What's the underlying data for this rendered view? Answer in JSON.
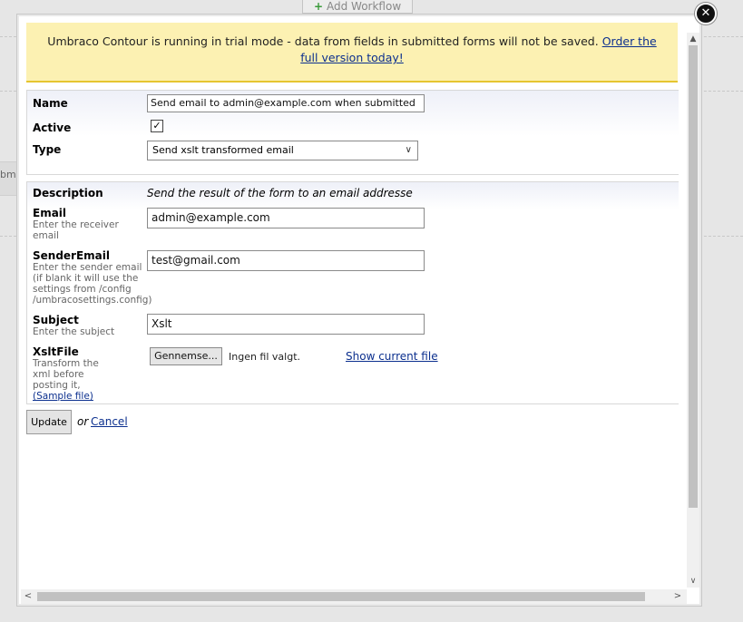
{
  "background": {
    "add_workflow_label": "Add Workflow",
    "side_text": "bm"
  },
  "dialog": {
    "close_glyph": "✕",
    "notice": {
      "text": "Umbraco Contour is running in trial mode - data from fields in submitted forms will not be saved.",
      "link": "Order the full version today!"
    },
    "general": {
      "name_label": "Name",
      "name_value": "Send email to admin@example.com when submitted",
      "active_label": "Active",
      "active_checked": true,
      "active_check_glyph": "✓",
      "type_label": "Type",
      "type_value": "Send xslt transformed email"
    },
    "settings": {
      "description_label": "Description",
      "description_value": "Send the result of the form to an email addresse",
      "email": {
        "label": "Email",
        "hint": "Enter the receiver email",
        "value": "admin@example.com"
      },
      "sender_email": {
        "label": "SenderEmail",
        "hint": "Enter the sender email (if blank it will use the settings from /config /umbracosettings.config)",
        "value": "test@gmail.com"
      },
      "subject": {
        "label": "Subject",
        "hint": "Enter the subject",
        "value": "Xslt"
      },
      "xslt_file": {
        "label": "XsltFile",
        "hint": "Transform the xml before posting it,",
        "sample_link": "(Sample file)",
        "browse_button": "Gennemse...",
        "no_file_text": "Ingen fil valgt.",
        "show_current_link": "Show current file"
      }
    },
    "actions": {
      "update_button": "Update",
      "or_text": "or",
      "cancel_link": "Cancel"
    }
  },
  "icons": {
    "close": "close-icon",
    "dropdown": "chevron-down-icon",
    "scroll_up": "chevron-up-icon",
    "scroll_down": "chevron-down-icon",
    "scroll_left": "chevron-left-icon",
    "scroll_right": "chevron-right-icon"
  },
  "colors": {
    "notice_bg": "#fcf1b2",
    "notice_border": "#e6c530",
    "link": "#0b2f8e"
  }
}
